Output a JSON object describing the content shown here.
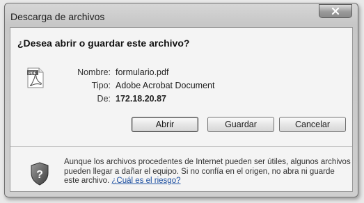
{
  "window": {
    "title": "Descarga de archivos",
    "close_label": "×"
  },
  "dialog": {
    "question": "¿Desea abrir o guardar este archivo?",
    "file_icon": "pdf-file-icon",
    "fields": {
      "name_label": "Nombre:",
      "name_value": "formulario.pdf",
      "type_label": "Tipo:",
      "type_value": "Adobe Acrobat Document",
      "from_label": "De:",
      "from_value": "172.18.20.87"
    },
    "buttons": {
      "open": "Abrir",
      "save": "Guardar",
      "cancel": "Cancelar"
    }
  },
  "warning": {
    "icon": "shield-question-icon",
    "text": "Aunque los archivos procedentes de Internet pueden ser útiles, algunos archivos pueden llegar a dañar el equipo. Si no confía en el origen, no abra ni guarde este archivo.",
    "link": "¿Cuál es el riesgo?"
  },
  "colors": {
    "link": "#1c4fa0",
    "background": "#f4f4f4"
  }
}
